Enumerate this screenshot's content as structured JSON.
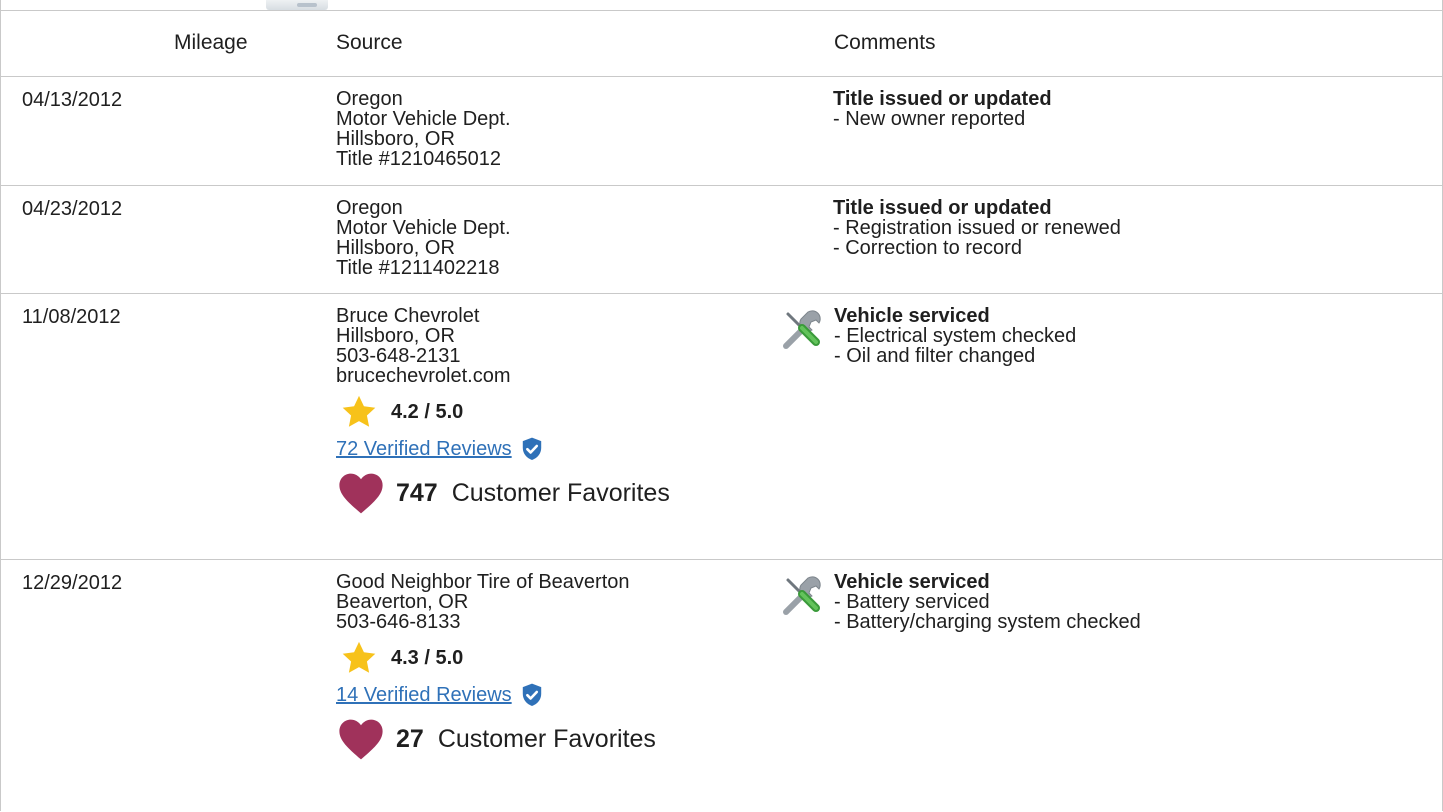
{
  "header": {
    "mileage": "Mileage",
    "source": "Source",
    "comments": "Comments"
  },
  "records": [
    {
      "date": "04/13/2012",
      "source_lines": [
        "Oregon",
        "Motor Vehicle Dept.",
        "Hillsboro, OR",
        "Title #1210465012"
      ],
      "comment_title": "Title issued or updated",
      "comment_lines": [
        "- New owner reported"
      ]
    },
    {
      "date": "04/23/2012",
      "source_lines": [
        "Oregon",
        "Motor Vehicle Dept.",
        "Hillsboro, OR",
        "Title #1211402218"
      ],
      "comment_title": "Title issued or updated",
      "comment_lines": [
        "- Registration issued or renewed",
        "- Correction to record"
      ]
    },
    {
      "date": "11/08/2012",
      "source_lines": [
        "Bruce Chevrolet",
        "Hillsboro, OR",
        "503-648-2131",
        "brucechevrolet.com"
      ],
      "rating": "4.2 / 5.0",
      "reviews": "72 Verified Reviews",
      "favorites_count": "747",
      "favorites_label": "Customer Favorites",
      "comment_icon": "service-tools-icon",
      "comment_title": "Vehicle serviced",
      "comment_lines": [
        "- Electrical system checked",
        "- Oil and filter changed"
      ]
    },
    {
      "date": "12/29/2012",
      "source_lines": [
        "Good Neighbor Tire of Beaverton",
        "Beaverton, OR",
        "503-646-8133"
      ],
      "rating": "4.3 / 5.0",
      "reviews": "14 Verified Reviews",
      "favorites_count": "27",
      "favorites_label": "Customer Favorites",
      "comment_icon": "service-tools-icon",
      "comment_title": "Vehicle serviced",
      "comment_lines": [
        "- Battery serviced",
        "- Battery/charging system checked"
      ]
    }
  ],
  "colors": {
    "link": "#2f71b8",
    "star": "#f7c21a",
    "heart": "#a0325b",
    "verified_badge": "#2f71b8",
    "border": "#c9c9c9"
  }
}
